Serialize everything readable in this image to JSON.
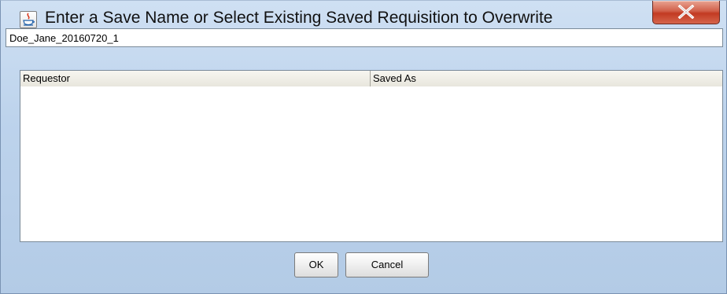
{
  "window": {
    "title": "Enter a Save Name or Select Existing Saved Requisition to Overwrite",
    "icon": "java-coffee-icon",
    "close_icon": "close-icon"
  },
  "form": {
    "save_name_value": "Doe_Jane_20160720_1"
  },
  "table": {
    "columns": [
      "Requestor",
      "Saved As"
    ],
    "rows": []
  },
  "buttons": {
    "ok_label": "OK",
    "cancel_label": "Cancel"
  },
  "colors": {
    "close_button": "#c23a22",
    "dialog_frame": "#bdd3ec",
    "panel_background": "#eeece2"
  }
}
